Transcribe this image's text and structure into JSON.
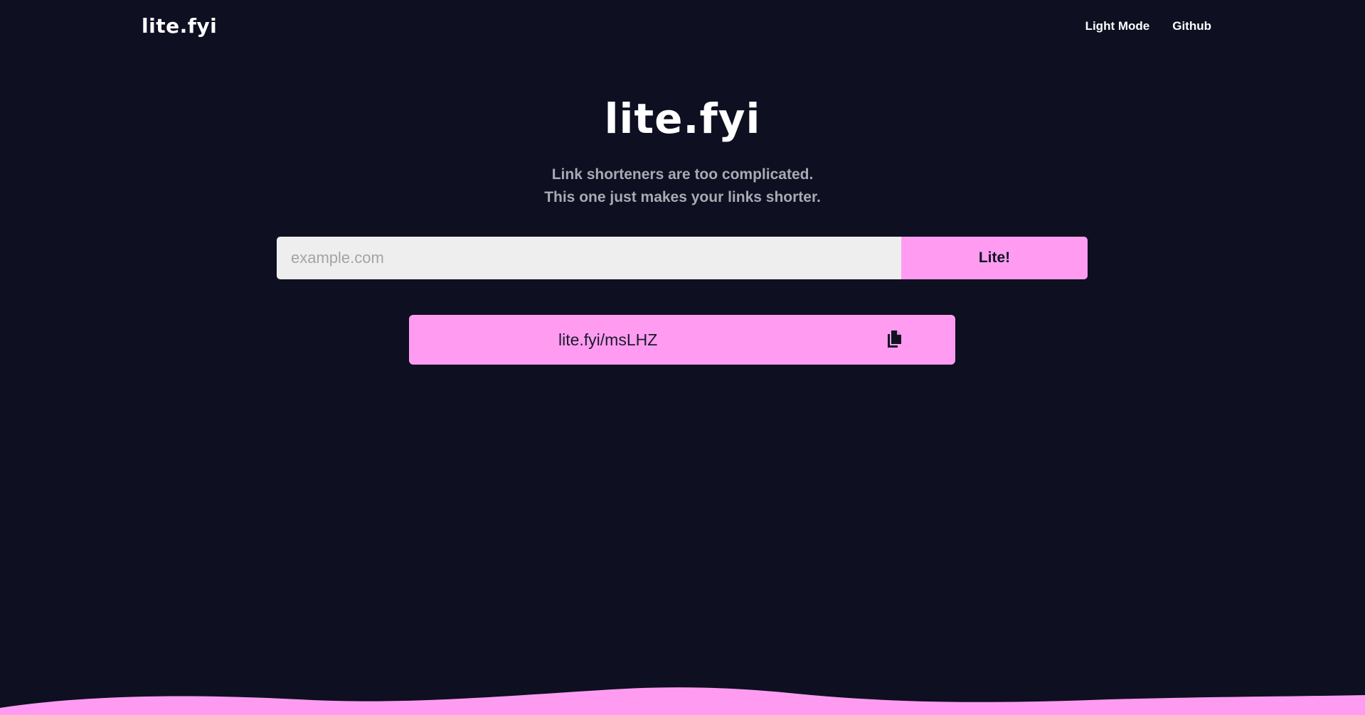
{
  "header": {
    "brand": "lite.fyi",
    "nav": {
      "light_mode": "Light Mode",
      "github": "Github"
    }
  },
  "hero": {
    "title": "lite.fyi",
    "tagline_line1": "Link shorteners are too complicated.",
    "tagline_line2": "This one just makes your links shorter."
  },
  "form": {
    "input_placeholder": "example.com",
    "input_value": "",
    "submit_label": "Lite!"
  },
  "result": {
    "short_link": "lite.fyi/msLHZ",
    "copy_icon": "copy-icon"
  },
  "colors": {
    "background": "#0e0f21",
    "accent": "#ff9cf2",
    "input_background": "#eeeeee",
    "text_primary": "#ffffff",
    "text_muted": "#a9aab2"
  }
}
